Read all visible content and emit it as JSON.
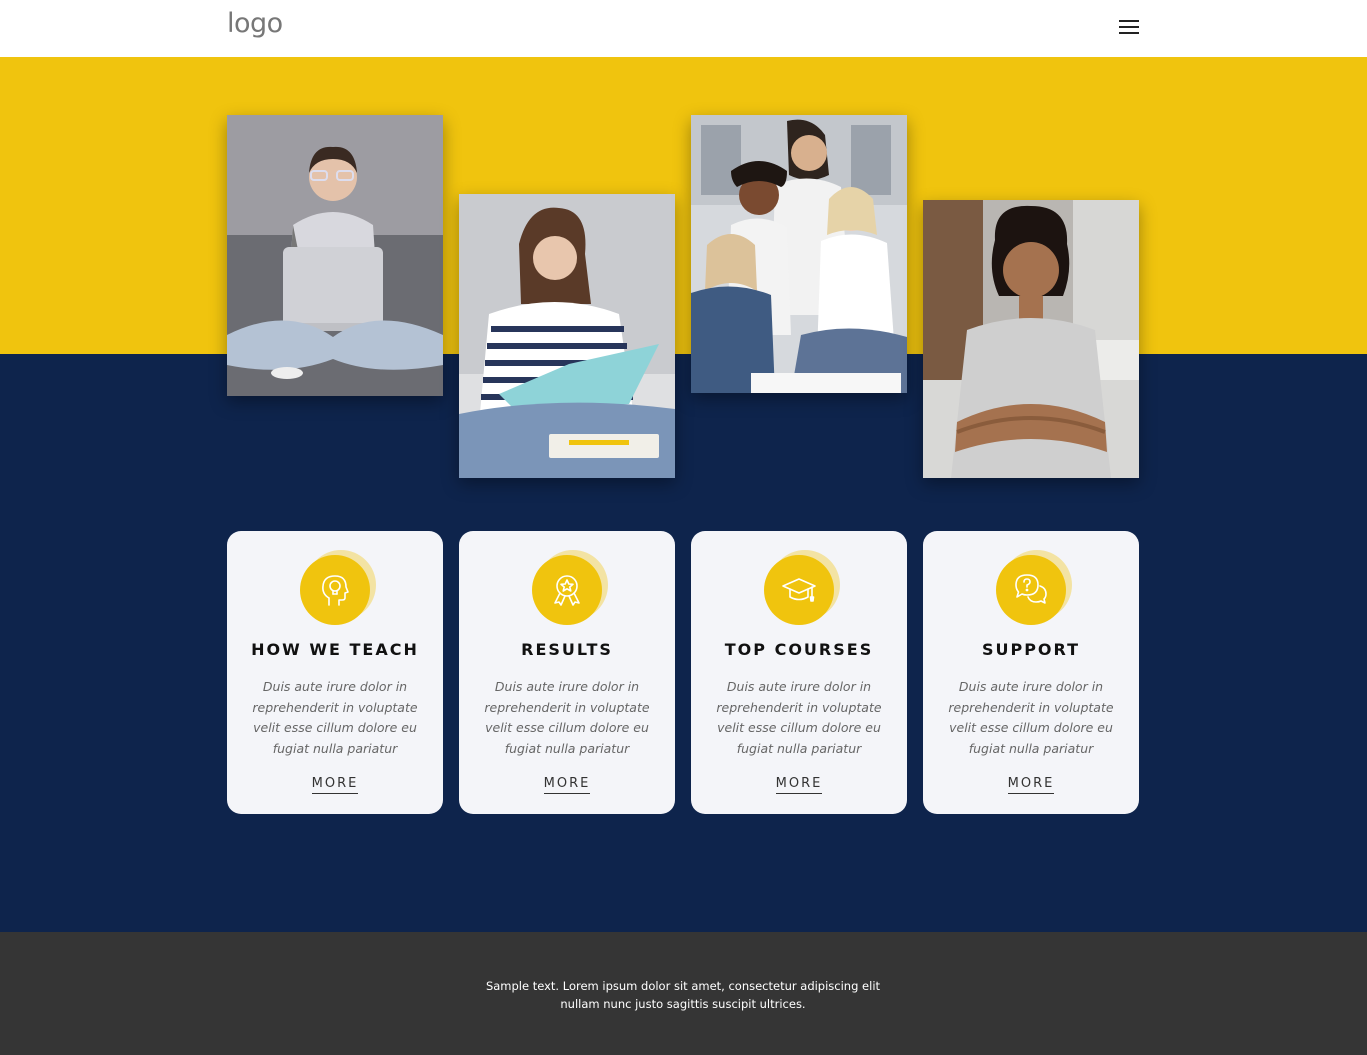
{
  "header": {
    "logo_text": "logo",
    "menu_icon": "hamburger-menu-icon"
  },
  "colors": {
    "yellow": "#f0c40e",
    "navy": "#0e244c",
    "card_bg": "#f4f5f9",
    "footer_bg": "#353535"
  },
  "photos": [
    {
      "alt": "student-with-laptop"
    },
    {
      "alt": "student-reading-notebook"
    },
    {
      "alt": "group-of-students"
    },
    {
      "alt": "smiling-student-arms-crossed"
    }
  ],
  "cards": [
    {
      "icon": "head-lightbulb-icon",
      "title": "HOW WE TEACH",
      "text": "Duis aute irure dolor in reprehenderit in voluptate velit esse cillum dolore eu fugiat nulla pariatur",
      "more": "MORE"
    },
    {
      "icon": "award-badge-icon",
      "title": "RESULTS",
      "text": "Duis aute irure dolor in reprehenderit in voluptate velit esse cillum dolore eu fugiat nulla pariatur",
      "more": "MORE"
    },
    {
      "icon": "graduation-cap-icon",
      "title": "TOP COURSES",
      "text": "Duis aute irure dolor in reprehenderit in voluptate velit esse cillum dolore eu fugiat nulla pariatur",
      "more": "MORE"
    },
    {
      "icon": "question-chat-icon",
      "title": "SUPPORT",
      "text": "Duis aute irure dolor in reprehenderit in voluptate velit esse cillum dolore eu fugiat nulla pariatur",
      "more": "MORE"
    }
  ],
  "footer": {
    "text": "Sample text. Lorem ipsum dolor sit amet, consectetur adipiscing elit nullam nunc justo sagittis suscipit ultrices."
  }
}
